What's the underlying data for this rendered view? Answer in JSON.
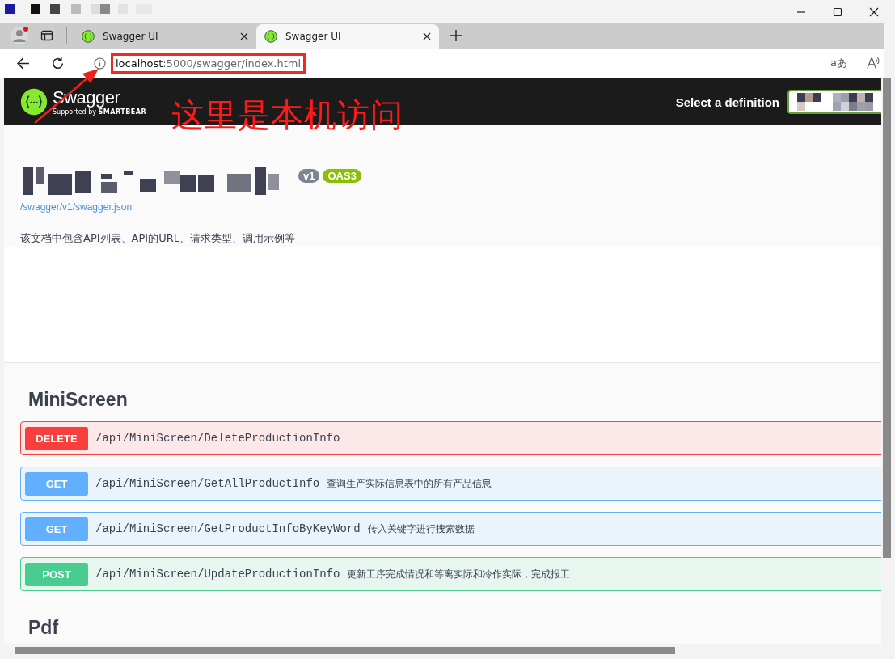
{
  "tabs": [
    {
      "title": "Swagger UI",
      "selected": false
    },
    {
      "title": "Swagger UI",
      "selected": true
    }
  ],
  "address": {
    "host": "localhost",
    "rest": ":5000/swagger/index.html",
    "translate_label": "aあ"
  },
  "header": {
    "logo_text": "Swagger",
    "logo_sub": "Supported by",
    "logo_brand": "SMARTBEAR",
    "definition_label": "Select a definition"
  },
  "info": {
    "version": "v1",
    "spec": "OAS3",
    "url": "/swagger/v1/swagger.json",
    "description": "该文档中包含API列表、API的URL、请求类型、调用示例等"
  },
  "sections": [
    {
      "name": "MiniScreen",
      "operations": [
        {
          "kind": "delete",
          "method": "DELETE",
          "path": "/api/MiniScreen/DeleteProductionInfo"
        },
        {
          "kind": "get",
          "method": "GET",
          "path": "/api/MiniScreen/GetAllProductInfo",
          "summary": "查询生产实际信息表中的所有产品信息"
        },
        {
          "kind": "get",
          "method": "GET",
          "path": "/api/MiniScreen/GetProductInfoByKeyWord",
          "summary": "传入关键字进行搜索数据"
        },
        {
          "kind": "post",
          "method": "POST",
          "path": "/api/MiniScreen/UpdateProductionInfo",
          "summary": "更新工序完成情况和等离实际和冷作实际，完成报工"
        }
      ]
    },
    {
      "name": "Pdf"
    }
  ],
  "annotation": {
    "text": "这里是本机访问"
  }
}
